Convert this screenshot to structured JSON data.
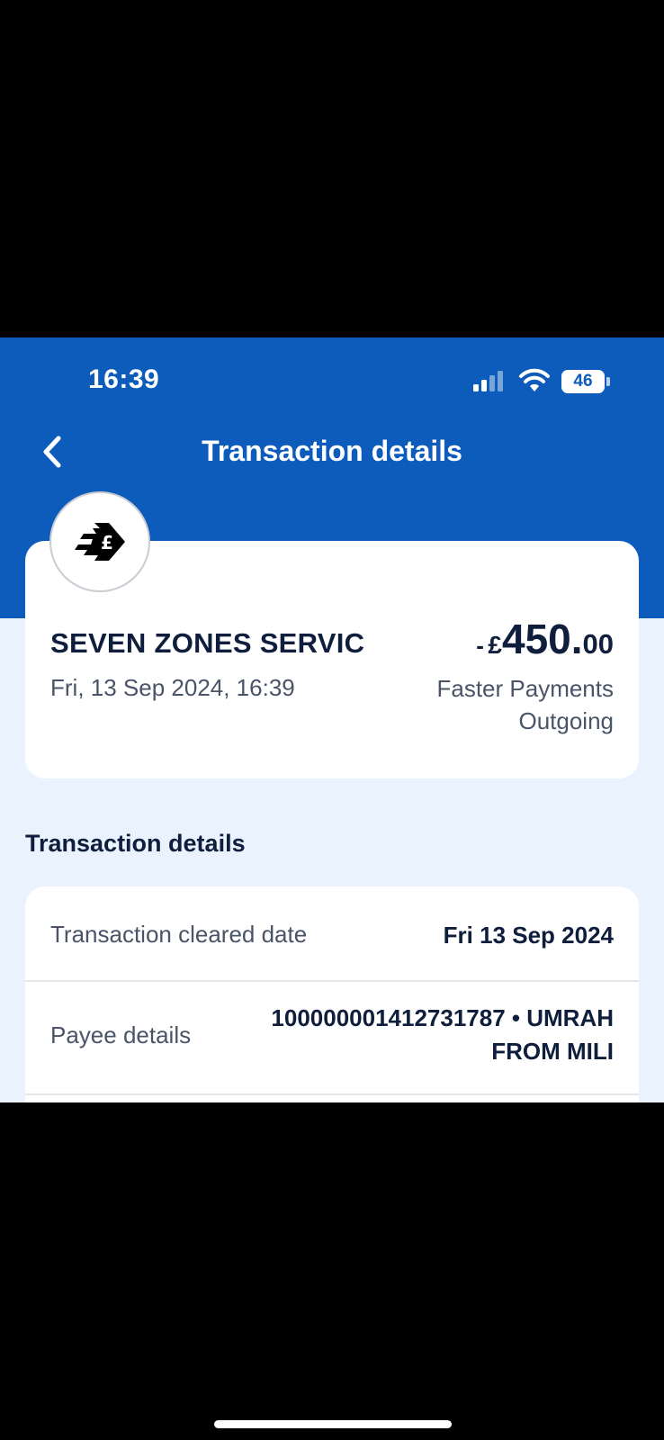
{
  "status_bar": {
    "time": "16:39",
    "battery": "46",
    "icons": [
      "signal-icon",
      "wifi-icon",
      "battery-icon"
    ]
  },
  "nav": {
    "title": "Transaction details",
    "back_icon": "chevron-left-icon"
  },
  "summary": {
    "merchant_icon": "faster-payment-pound-icon",
    "merchant_name": "SEVEN ZONES SERVIC",
    "datetime": "Fri, 13 Sep 2024, 16:39",
    "amount_sign": "-",
    "amount_currency": "£",
    "amount_whole": "450.",
    "amount_decimal": "00",
    "payment_type_line1": "Faster Payments",
    "payment_type_line2": "Outgoing"
  },
  "details": {
    "section_title": "Transaction details",
    "rows": [
      {
        "label": "Transaction cleared date",
        "value": "Fri 13 Sep 2024"
      },
      {
        "label": "Payee details",
        "value": "100000001412731787 • UMRAH FROM MILI"
      }
    ]
  },
  "colors": {
    "header_blue": "#0d5cbb",
    "page_background": "#eaf2fd",
    "text_primary": "#0f1e3c",
    "text_secondary": "#4a5468"
  }
}
